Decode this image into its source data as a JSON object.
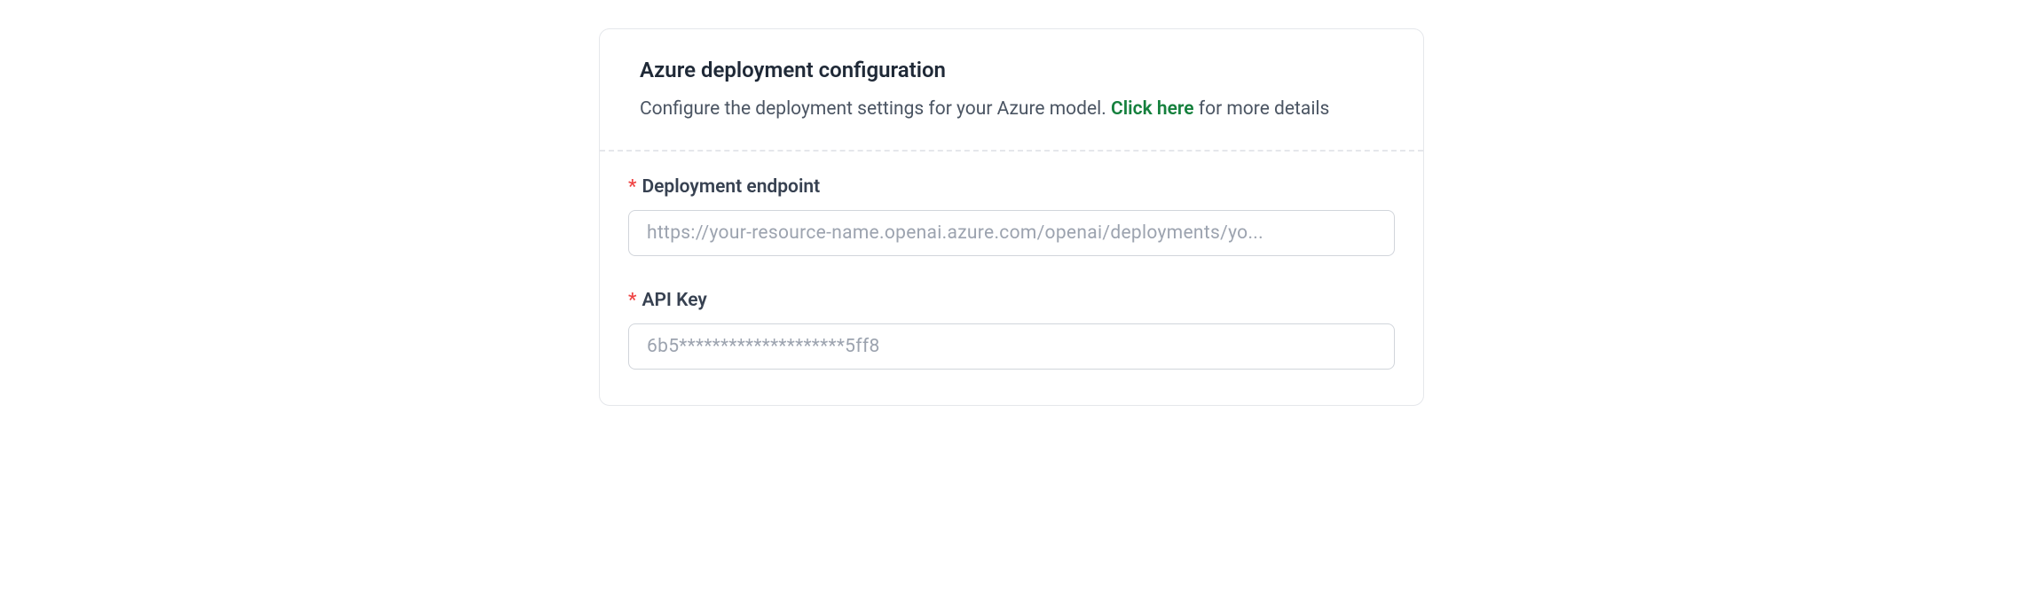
{
  "header": {
    "title": "Azure deployment configuration",
    "description_before_link": "Configure the deployment settings for your Azure model. ",
    "link_text": "Click here",
    "description_after_link": " for more details"
  },
  "form": {
    "endpoint": {
      "required_mark": "*",
      "label": "Deployment endpoint",
      "placeholder": "https://your-resource-name.openai.azure.com/openai/deployments/yo...",
      "value": ""
    },
    "api_key": {
      "required_mark": "*",
      "label": "API Key",
      "placeholder": "6b5********************5ff8",
      "value": ""
    }
  }
}
